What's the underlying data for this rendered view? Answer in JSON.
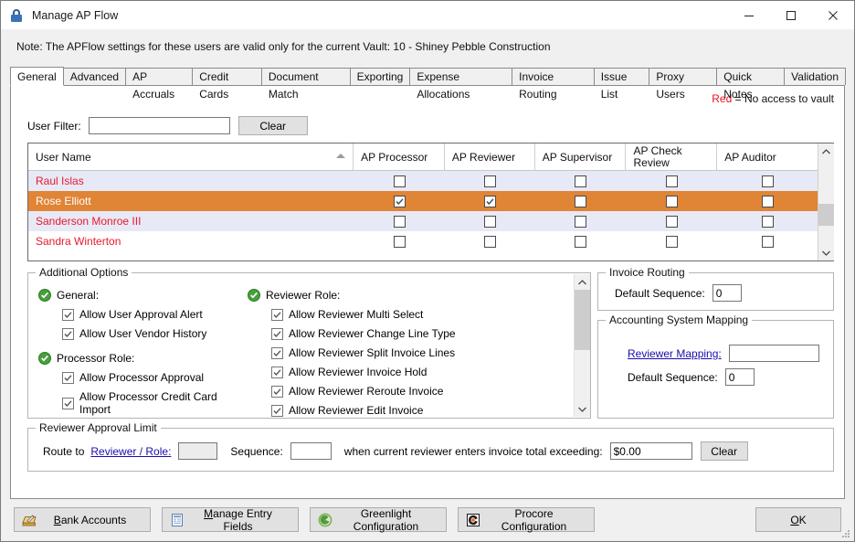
{
  "window": {
    "title": "Manage AP Flow",
    "icon": "lock-icon",
    "minimize": "minimize",
    "maximize": "maximize",
    "close": "close"
  },
  "note": "Note:  The APFlow settings for these users are valid only for the current Vault: 10 - Shiney Pebble Construction",
  "tabs": [
    {
      "label": "General",
      "active": true
    },
    {
      "label": "Advanced",
      "active": false
    },
    {
      "label": "AP Accruals",
      "active": false
    },
    {
      "label": "Credit Cards",
      "active": false
    },
    {
      "label": "Document Match",
      "active": false
    },
    {
      "label": "Exporting",
      "active": false
    },
    {
      "label": "Expense Allocations",
      "active": false
    },
    {
      "label": "Invoice Routing",
      "active": false
    },
    {
      "label": "Issue List",
      "active": false
    },
    {
      "label": "Proxy Users",
      "active": false
    },
    {
      "label": "Quick Notes",
      "active": false
    },
    {
      "label": "Validation",
      "active": false
    }
  ],
  "legend": {
    "keyword": "Red",
    "text": "= No access to vault",
    "color": "#e81123"
  },
  "filter": {
    "label": "User Filter:",
    "value": "",
    "placeholder": "",
    "clear_label": "Clear"
  },
  "grid": {
    "columns": [
      "User Name",
      "AP Processor",
      "AP Reviewer",
      "AP Supervisor",
      "AP Check Review",
      "AP Auditor"
    ],
    "sort_column": "User Name",
    "sort_direction": "ascending",
    "rows": [
      {
        "name": "Raul Islas",
        "selected": false,
        "checks": [
          false,
          false,
          false,
          false,
          false
        ]
      },
      {
        "name": "Rose Elliott",
        "selected": true,
        "checks": [
          true,
          true,
          false,
          false,
          false
        ]
      },
      {
        "name": "Sanderson Monroe III",
        "selected": false,
        "checks": [
          false,
          false,
          false,
          false,
          false
        ]
      },
      {
        "name": "Sandra Winterton",
        "selected": false,
        "checks": [
          false,
          false,
          false,
          false,
          false
        ]
      }
    ],
    "selected_row_color": "#e08435",
    "alt_row_color": "#e8e9f7",
    "no_access_color": "#e8192c"
  },
  "additional_options": {
    "caption": "Additional Options",
    "groups": [
      {
        "heading": "General:",
        "items": [
          {
            "label": "Allow User Approval Alert",
            "checked": true
          },
          {
            "label": "Allow User Vendor History",
            "checked": true
          }
        ]
      },
      {
        "heading": "Processor Role:",
        "items": [
          {
            "label": "Allow Processor Approval",
            "checked": true
          },
          {
            "label": "Allow Processor Credit Card Import",
            "checked": true
          }
        ]
      }
    ],
    "groups_right": [
      {
        "heading": "Reviewer Role:",
        "items": [
          {
            "label": "Allow Reviewer Multi Select",
            "checked": true
          },
          {
            "label": "Allow Reviewer Change Line Type",
            "checked": true
          },
          {
            "label": "Allow Reviewer Split Invoice Lines",
            "checked": true
          },
          {
            "label": "Allow Reviewer Invoice Hold",
            "checked": true
          },
          {
            "label": "Allow Reviewer Reroute Invoice",
            "checked": true
          },
          {
            "label": "Allow Reviewer Edit Invoice",
            "checked": true
          }
        ]
      }
    ]
  },
  "invoice_routing": {
    "caption": "Invoice Routing",
    "default_sequence_label": "Default Sequence:",
    "default_sequence_value": "0"
  },
  "accounting_mapping": {
    "caption": "Accounting System Mapping",
    "reviewer_mapping_label": "Reviewer Mapping:",
    "reviewer_mapping_value": "",
    "default_sequence_label": "Default Sequence:",
    "default_sequence_value": "0"
  },
  "reviewer_approval_limit": {
    "caption": "Reviewer Approval Limit",
    "route_to_label": "Route to",
    "reviewer_role_link": "Reviewer / Role:",
    "reviewer_role_value": "",
    "sequence_label": "Sequence:",
    "sequence_value": "",
    "condition_text": "when current reviewer enters invoice total exceeding:",
    "amount_value": "$0.00",
    "clear_label": "Clear"
  },
  "footer": {
    "buttons": [
      {
        "label": "Bank Accounts",
        "accel": "B",
        "icon": "bank-accounts-icon"
      },
      {
        "label": "Manage Entry Fields",
        "accel": "M",
        "icon": "manage-entry-fields-icon"
      },
      {
        "label": "Greenlight Configuration",
        "accel": "",
        "icon": "greenlight-icon"
      },
      {
        "label": "Procore Configuration",
        "accel": "",
        "icon": "procore-icon"
      }
    ],
    "ok_label": "OK",
    "ok_accel": "O"
  }
}
